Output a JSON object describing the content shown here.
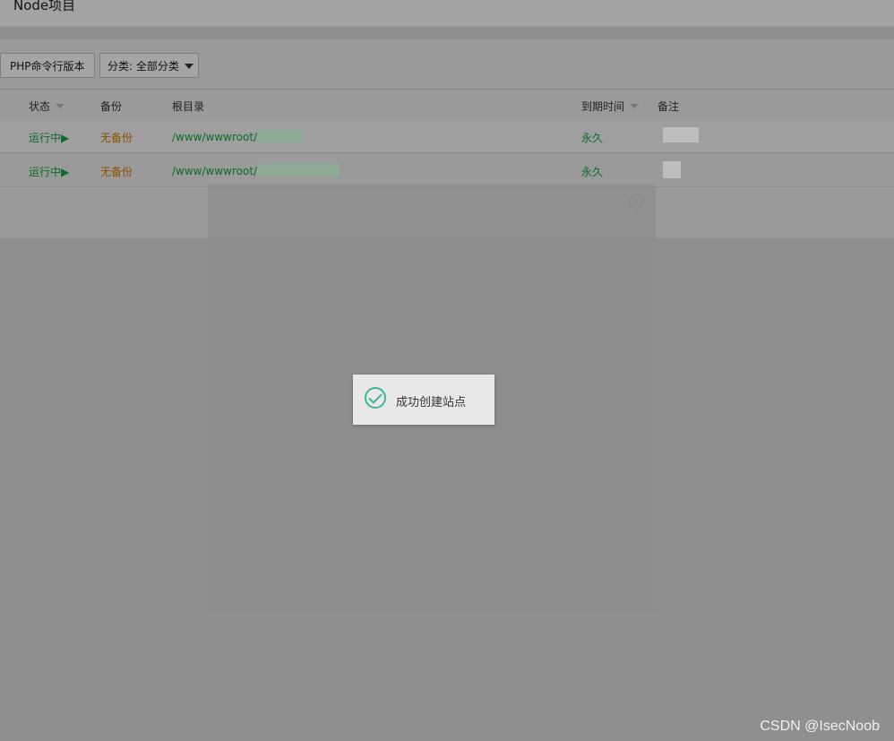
{
  "header": {
    "title": "Node项目"
  },
  "toolbar": {
    "php_cli_label": "PHP命令行版本",
    "category_label": "分类: 全部分类"
  },
  "table": {
    "columns": {
      "status": "状态",
      "backup": "备份",
      "root": "根目录",
      "expiry": "到期时间",
      "note": "备注"
    },
    "rows": [
      {
        "status": "运行中▶",
        "backup": "无备份",
        "root": "/www/wwwroot/",
        "expiry": "永久"
      },
      {
        "status": "运行中▶",
        "backup": "无备份",
        "root": "/www/wwwroot/",
        "expiry": "永久"
      }
    ]
  },
  "toast": {
    "message": "成功创建站点",
    "icon": "check-circle-icon",
    "accent": "#3fb59a"
  },
  "watermark": "CSDN @IsecNoob"
}
